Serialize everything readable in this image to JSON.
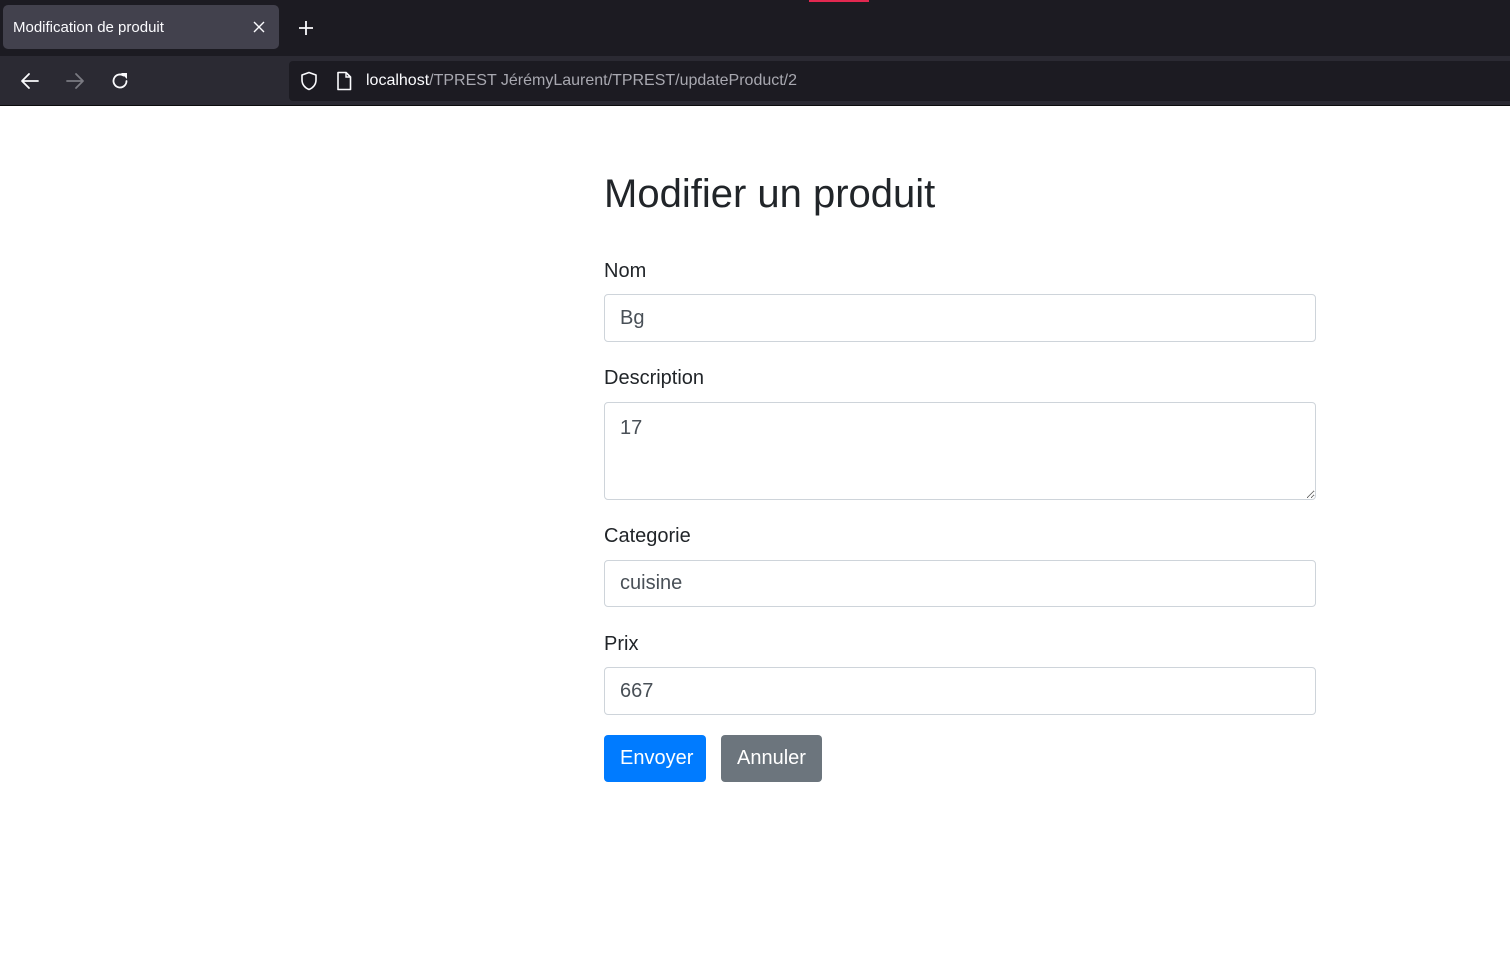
{
  "browser": {
    "tab": {
      "title": "Modification de produit",
      "close_icon": "close-icon"
    },
    "new_tab_icon": "plus-icon",
    "nav": {
      "back_icon": "arrow-left-icon",
      "forward_icon": "arrow-right-icon",
      "reload_icon": "reload-icon"
    },
    "url": {
      "host": "localhost",
      "path": "/TPREST JérémyLaurent/TPREST/updateProduct/2",
      "security_icon": "shield-icon",
      "page_icon": "page-icon"
    }
  },
  "page": {
    "title": "Modifier un produit",
    "form": {
      "nom": {
        "label": "Nom",
        "value": "Bg"
      },
      "description": {
        "label": "Description",
        "value": "17"
      },
      "categorie": {
        "label": "Categorie",
        "value": "cuisine"
      },
      "prix": {
        "label": "Prix",
        "value": "667"
      }
    },
    "buttons": {
      "submit": "Envoyer",
      "cancel": "Annuler"
    }
  },
  "colors": {
    "primary": "#007bff",
    "secondary": "#6c757d",
    "chrome_dark": "#1c1b22",
    "chrome_toolbar": "#2b2a33",
    "accent": "#e22850"
  }
}
